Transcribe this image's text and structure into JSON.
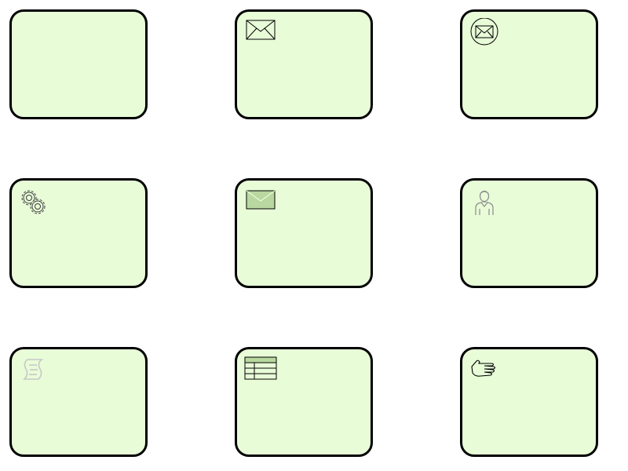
{
  "colors": {
    "task_fill": "#e8fcd8",
    "task_stroke": "#000000",
    "icon_fill": "#c8f0b0",
    "icon_stroke": "#000000",
    "faded_icon_stroke": "#9a9a9a"
  },
  "tasks": [
    {
      "type": "task",
      "icon": "none"
    },
    {
      "type": "send-task",
      "icon": "envelope-icon"
    },
    {
      "type": "receive-task",
      "icon": "envelope-in-circle-icon"
    },
    {
      "type": "service-task",
      "icon": "gears-icon"
    },
    {
      "type": "message-task",
      "icon": "filled-envelope-icon"
    },
    {
      "type": "user-task",
      "icon": "user-icon"
    },
    {
      "type": "script-task",
      "icon": "script-scroll-icon"
    },
    {
      "type": "business-rule-task",
      "icon": "rule-table-icon"
    },
    {
      "type": "manual-task",
      "icon": "hand-icon"
    }
  ]
}
